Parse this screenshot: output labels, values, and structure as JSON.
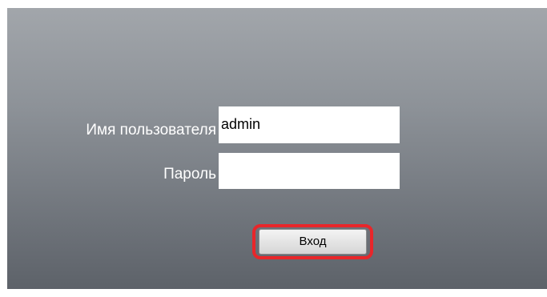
{
  "login_form": {
    "username_label": "Имя пользователя",
    "username_value": "admin",
    "password_label": "Пароль",
    "password_value": "",
    "submit_label": "Вход"
  },
  "colors": {
    "panel_top": "#a2a6ab",
    "panel_bottom": "#5d6269",
    "highlight": "#e8262a",
    "label_text": "#ffffff"
  }
}
